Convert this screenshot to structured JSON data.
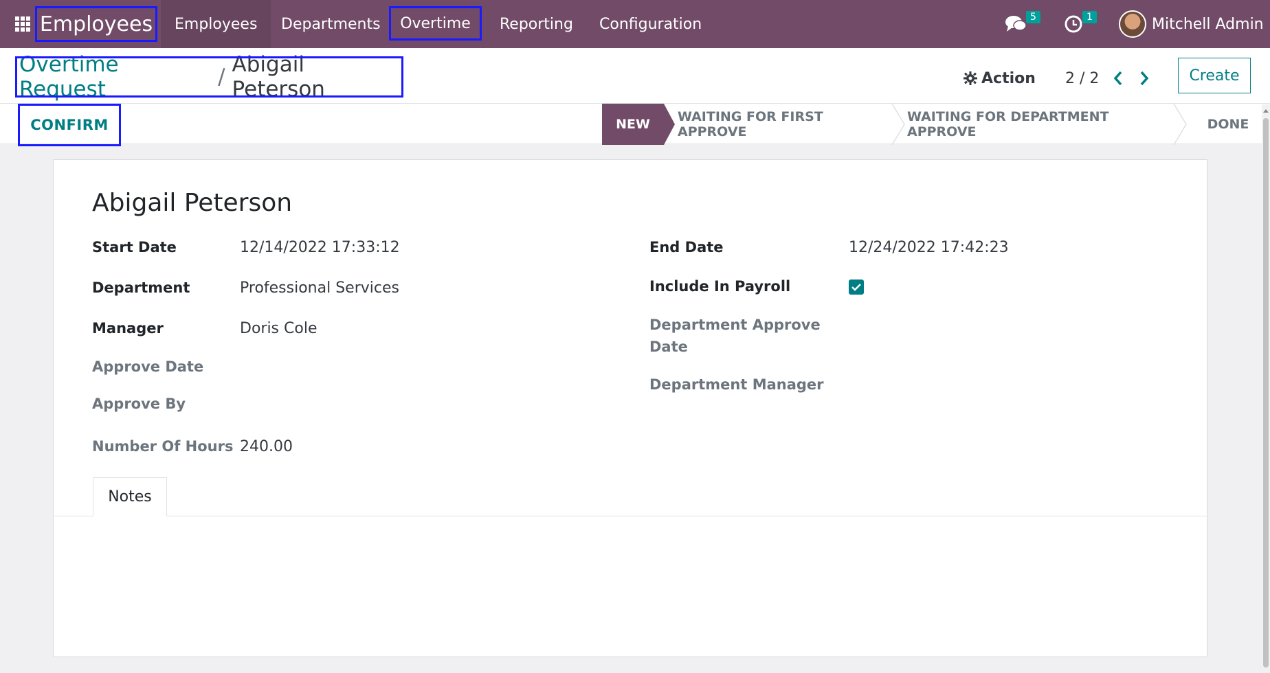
{
  "navbar": {
    "brand": "Employees",
    "items": [
      {
        "label": "Employees"
      },
      {
        "label": "Departments"
      },
      {
        "label": "Overtime"
      },
      {
        "label": "Reporting"
      },
      {
        "label": "Configuration"
      }
    ],
    "messages_count": "5",
    "activities_count": "1",
    "user_name": "Mitchell Admin",
    "brand_color": "#714b67"
  },
  "breadcrumb": {
    "parent": "Overtime Request",
    "separator": "/",
    "current": "Abigail Peterson"
  },
  "controls": {
    "action_label": "Action",
    "pager": "2 / 2",
    "create_label": "Create",
    "confirm_label": "CONFIRM"
  },
  "statusbar": {
    "stages": [
      "NEW",
      "WAITING FOR FIRST APPROVE",
      "WAITING FOR DEPARTMENT APPROVE",
      "DONE"
    ],
    "current": "NEW"
  },
  "record": {
    "name": "Abigail Peterson",
    "left": {
      "start_date_label": "Start Date",
      "start_date": "12/14/2022 17:33:12",
      "department_label": "Department",
      "department": "Professional Services",
      "manager_label": "Manager",
      "manager": "Doris Cole",
      "approve_date_label": "Approve Date",
      "approve_by_label": "Approve By",
      "hours_label": "Number Of Hours",
      "hours": "240.00"
    },
    "right": {
      "end_date_label": "End Date",
      "end_date": "12/24/2022 17:42:23",
      "payroll_label": "Include In Payroll",
      "payroll_checked": true,
      "dept_approve_date_label_1": "Department Approve",
      "dept_approve_date_label_2": "Date",
      "dept_manager_label": "Department Manager"
    }
  },
  "tabs": {
    "notes_label": "Notes"
  },
  "colors": {
    "accent": "#017e84",
    "highlight": "#1a1aff"
  }
}
